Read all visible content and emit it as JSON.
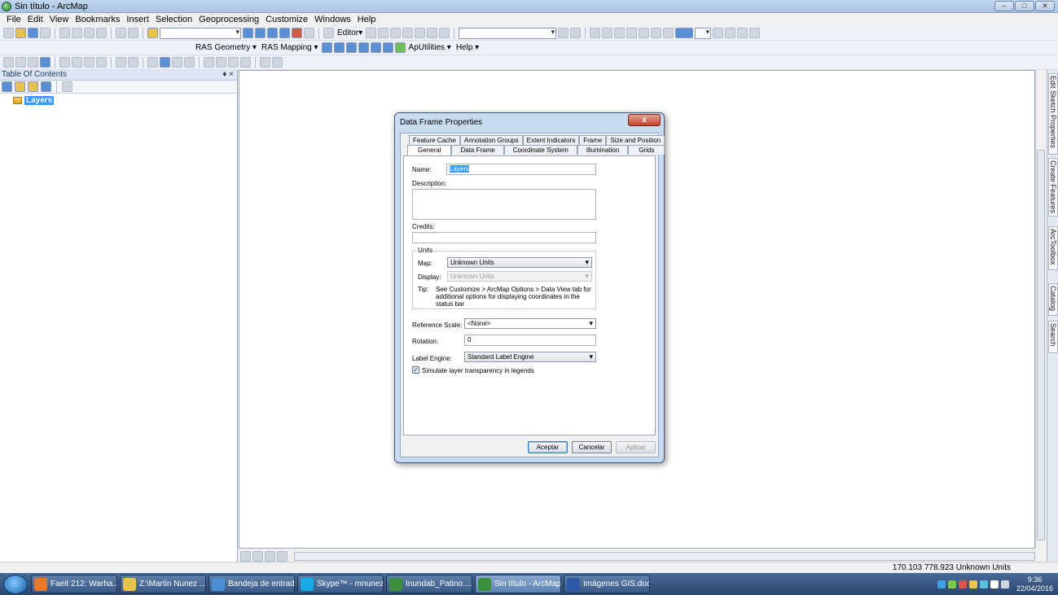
{
  "window": {
    "title": "Sin título - ArcMap",
    "controls": [
      "‒",
      "□",
      "✕"
    ]
  },
  "menu": [
    "File",
    "Edit",
    "View",
    "Bookmarks",
    "Insert",
    "Selection",
    "Geoprocessing",
    "Customize",
    "Windows",
    "Help"
  ],
  "toolbar1": {
    "editor_label": "Editor▾"
  },
  "toolbar2": {
    "ras_geometry": "RAS Geometry ▾",
    "ras_mapping": "RAS Mapping ▾",
    "aputilities": "ApUtilities ▾",
    "help": "Help ▾"
  },
  "toc": {
    "title": "Table Of Contents",
    "pin": "♦ ×",
    "root_layer": "Layers"
  },
  "dock_tabs": [
    "Edit Sketch Properties",
    "Create Features",
    "ArcToolbox",
    "Catalog",
    "Search"
  ],
  "status": {
    "coords": "170.103  778.923 Unknown Units"
  },
  "taskbar": {
    "items": [
      {
        "label": "Faeit 212: Warha...",
        "color": "#e8782a"
      },
      {
        "label": "Z:\\Martin Nunez ...",
        "color": "#e6c34a"
      },
      {
        "label": "Bandeja de entrad...",
        "color": "#4a8fd6"
      },
      {
        "label": "Skype™ - mnunez...",
        "color": "#17a9e8"
      },
      {
        "label": "Inundab_Patino....",
        "color": "#3c8f3c"
      },
      {
        "label": "Sin título - ArcMap",
        "color": "#3c8f3c"
      },
      {
        "label": "Imágenes GIS.doc...",
        "color": "#2d5aa8"
      }
    ],
    "time": "9:36",
    "date": "22/04/2016"
  },
  "dialog": {
    "title": "Data Frame Properties",
    "close": "x",
    "tabs_row1": [
      "Feature Cache",
      "Annotation Groups",
      "Extent Indicators",
      "Frame",
      "Size and Position"
    ],
    "tabs_row2": [
      "General",
      "Data Frame",
      "Coordinate System",
      "Illumination",
      "Grids"
    ],
    "name_label": "Name:",
    "name_value": "Layers",
    "description_label": "Description:",
    "credits_label": "Credits:",
    "units_group": "Units",
    "map_label": "Map:",
    "map_value": "Unknown Units",
    "display_label": "Display:",
    "display_value": "Unknown Units",
    "tip_label": "Tip:",
    "tip_text": "See Customize > ArcMap Options > Data View tab for additional options for displaying coordinates in the status bar",
    "refscale_label": "Reference Scale:",
    "refscale_value": "<None>",
    "rotation_label": "Rotation:",
    "rotation_value": "0",
    "labelengine_label": "Label Engine:",
    "labelengine_value": "Standard Label Engine",
    "simulate_label": "Simulate layer transparency in legends",
    "simulate_checked": "✓",
    "ok": "Aceptar",
    "cancel": "Cancelar",
    "apply": "Aplicar"
  }
}
